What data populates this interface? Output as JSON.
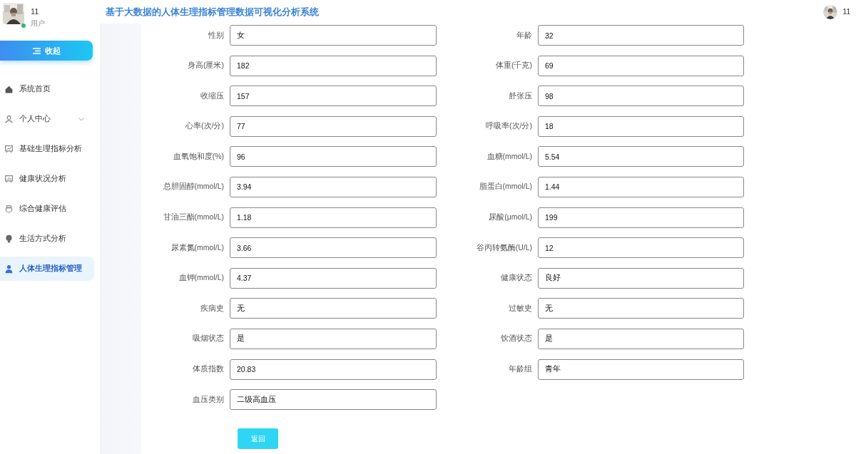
{
  "header": {
    "title": "基于大数据的人体生理指标管理数据可视化分析系统",
    "user_name": "11"
  },
  "sidebar": {
    "user": {
      "name": "11",
      "role": "用户",
      "online": true
    },
    "collapse_button": "收起",
    "items": [
      {
        "label": "系统首页",
        "kind": "link",
        "selected": false
      },
      {
        "label": "个人中心",
        "kind": "submenu",
        "selected": false
      },
      {
        "label": "基础生理指标分析",
        "kind": "link",
        "selected": false
      },
      {
        "label": "健康状况分析",
        "kind": "link",
        "selected": false
      },
      {
        "label": "综合健康评估",
        "kind": "link",
        "selected": false
      },
      {
        "label": "生活方式分析",
        "kind": "link",
        "selected": false
      },
      {
        "label": "人体生理指标管理",
        "kind": "link",
        "selected": true
      }
    ]
  },
  "form": {
    "fields": [
      {
        "label": "性别",
        "value": "女"
      },
      {
        "label": "年龄",
        "value": "32"
      },
      {
        "label": "身高(厘米)",
        "value": "182"
      },
      {
        "label": "体重(千克)",
        "value": "69"
      },
      {
        "label": "收缩压",
        "value": "157"
      },
      {
        "label": "舒张压",
        "value": "98"
      },
      {
        "label": "心率(次/分)",
        "value": "77"
      },
      {
        "label": "呼吸率(次/分)",
        "value": "18"
      },
      {
        "label": "血氧饱和度(%)",
        "value": "96"
      },
      {
        "label": "血糖(mmol/L)",
        "value": "5.54"
      },
      {
        "label": "总胆固醇(mmol/L)",
        "value": "3.94"
      },
      {
        "label": "脂蛋白(mmol/L)",
        "value": "1.44"
      },
      {
        "label": "甘油三酯(mmol/L)",
        "value": "1.18"
      },
      {
        "label": "尿酸(μmol/L)",
        "value": "199"
      },
      {
        "label": "尿素氮(mmol/L)",
        "value": "3.66"
      },
      {
        "label": "谷丙转氨酶(U/L)",
        "value": "12"
      },
      {
        "label": "血钾(mmol/L)",
        "value": "4.37"
      },
      {
        "label": "健康状态",
        "value": "良好"
      },
      {
        "label": "疾病史",
        "value": "无"
      },
      {
        "label": "过敏史",
        "value": "无"
      },
      {
        "label": "吸烟状态",
        "value": "是"
      },
      {
        "label": "饮酒状态",
        "value": "是"
      },
      {
        "label": "体质指数",
        "value": "20.83"
      },
      {
        "label": "年龄组",
        "value": "青年"
      },
      {
        "label": "血压类别",
        "value": "二级高血压"
      }
    ],
    "back_button": "返回"
  }
}
